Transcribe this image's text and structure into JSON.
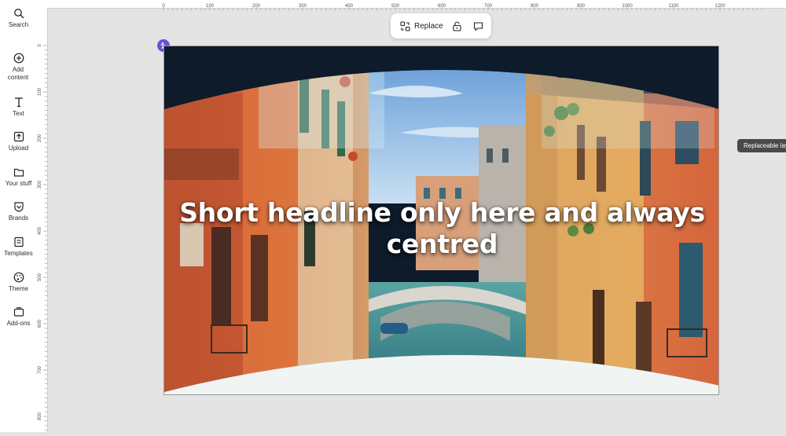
{
  "sidebar": {
    "items": [
      {
        "label": "Search",
        "icon": "search-icon"
      },
      {
        "label": "Add content",
        "icon": "add-circle-icon"
      },
      {
        "label": "Text",
        "icon": "text-icon"
      },
      {
        "label": "Upload",
        "icon": "upload-icon"
      },
      {
        "label": "Your stuff",
        "icon": "folder-icon"
      },
      {
        "label": "Brands",
        "icon": "brand-shield-icon"
      },
      {
        "label": "Templates",
        "icon": "templates-icon"
      },
      {
        "label": "Theme",
        "icon": "palette-icon"
      },
      {
        "label": "Add-ons",
        "icon": "addons-icon"
      }
    ]
  },
  "ruler": {
    "top_labels": [
      "0",
      "100",
      "200",
      "300",
      "400",
      "500",
      "600",
      "700",
      "800",
      "900",
      "1000",
      "1100",
      "1200"
    ],
    "left_labels": [
      "0",
      "100",
      "200",
      "300",
      "400",
      "500",
      "600",
      "700",
      "800"
    ]
  },
  "toolbar": {
    "replace_label": "Replace",
    "icons": [
      "replace-icon",
      "unlock-icon",
      "comment-icon"
    ]
  },
  "canvas": {
    "headline": "Short headline only here and always centred",
    "tooltip": "Replaceable layer",
    "colors": {
      "sky": "#7fb2e0",
      "water": "#3f8a8f",
      "wall_left": "#c8562e",
      "wall_right": "#d98b45",
      "curve": "#f0f5f4",
      "frame_dark": "#0e1b2a"
    }
  },
  "badge": {
    "icon": "accessibility-lock-icon",
    "color": "#6b4fd8"
  }
}
